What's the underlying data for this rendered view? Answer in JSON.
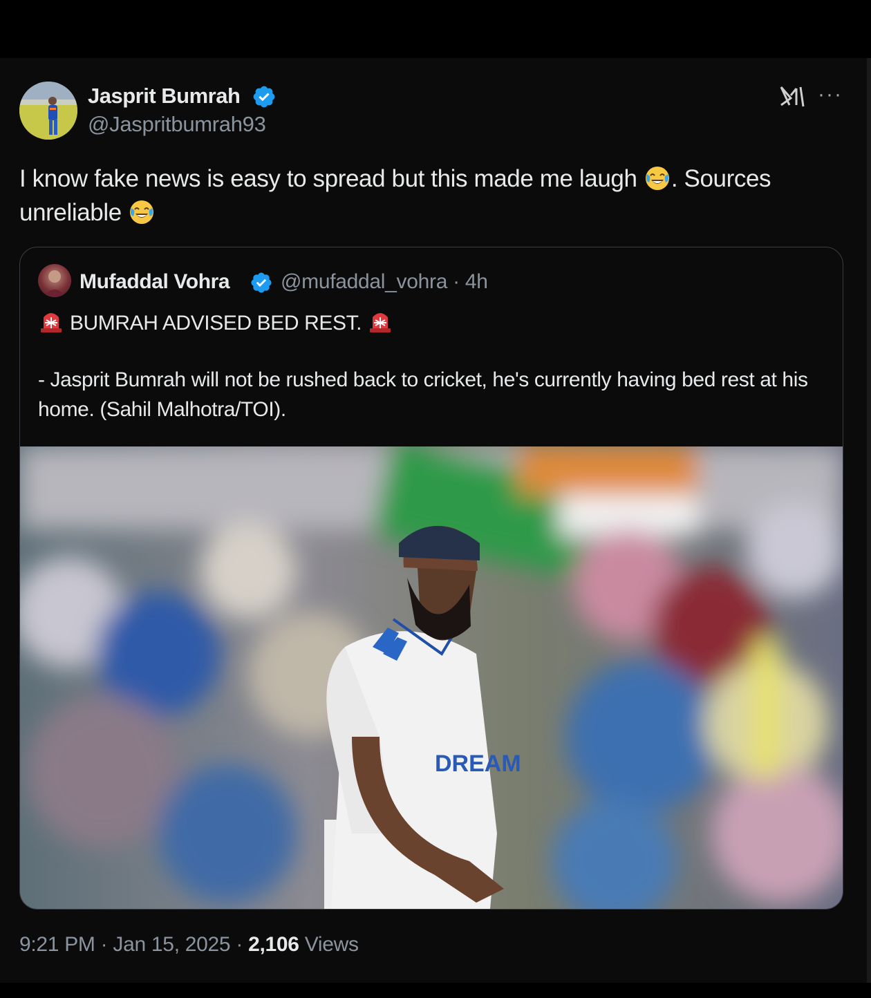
{
  "tweet": {
    "author_name": "Jasprit Bumrah",
    "author_handle": "@Jaspritbumrah93",
    "text_part1": "I know fake news is easy to spread but this made me laugh ",
    "text_part2": ".  Sources unreliable ",
    "emoji": "face-with-tears-of-joy",
    "time": "9:21 PM",
    "date": "Jan 15, 2025",
    "views_count": "2,106",
    "views_label": "Views",
    "separator": "·"
  },
  "quote": {
    "author_name": "Mufaddal Vohra",
    "author_handle": "@mufaddal_vohra",
    "time_ago": "4h",
    "separator": "·",
    "headline": "BUMRAH ADVISED BED REST.",
    "headline_icon": "police-light-siren",
    "body": "- Jasprit Bumrah will not be rushed back to cricket, he's currently having bed rest at his home. (Sahil Malhotra/TOI).",
    "image_jersey_text": "DREAM"
  },
  "colors": {
    "background": "#0b0b0b",
    "text_primary": "#e7e9ea",
    "text_secondary": "#8b949e",
    "verified_blue": "#1d9bf0",
    "border": "#3a3d41"
  }
}
